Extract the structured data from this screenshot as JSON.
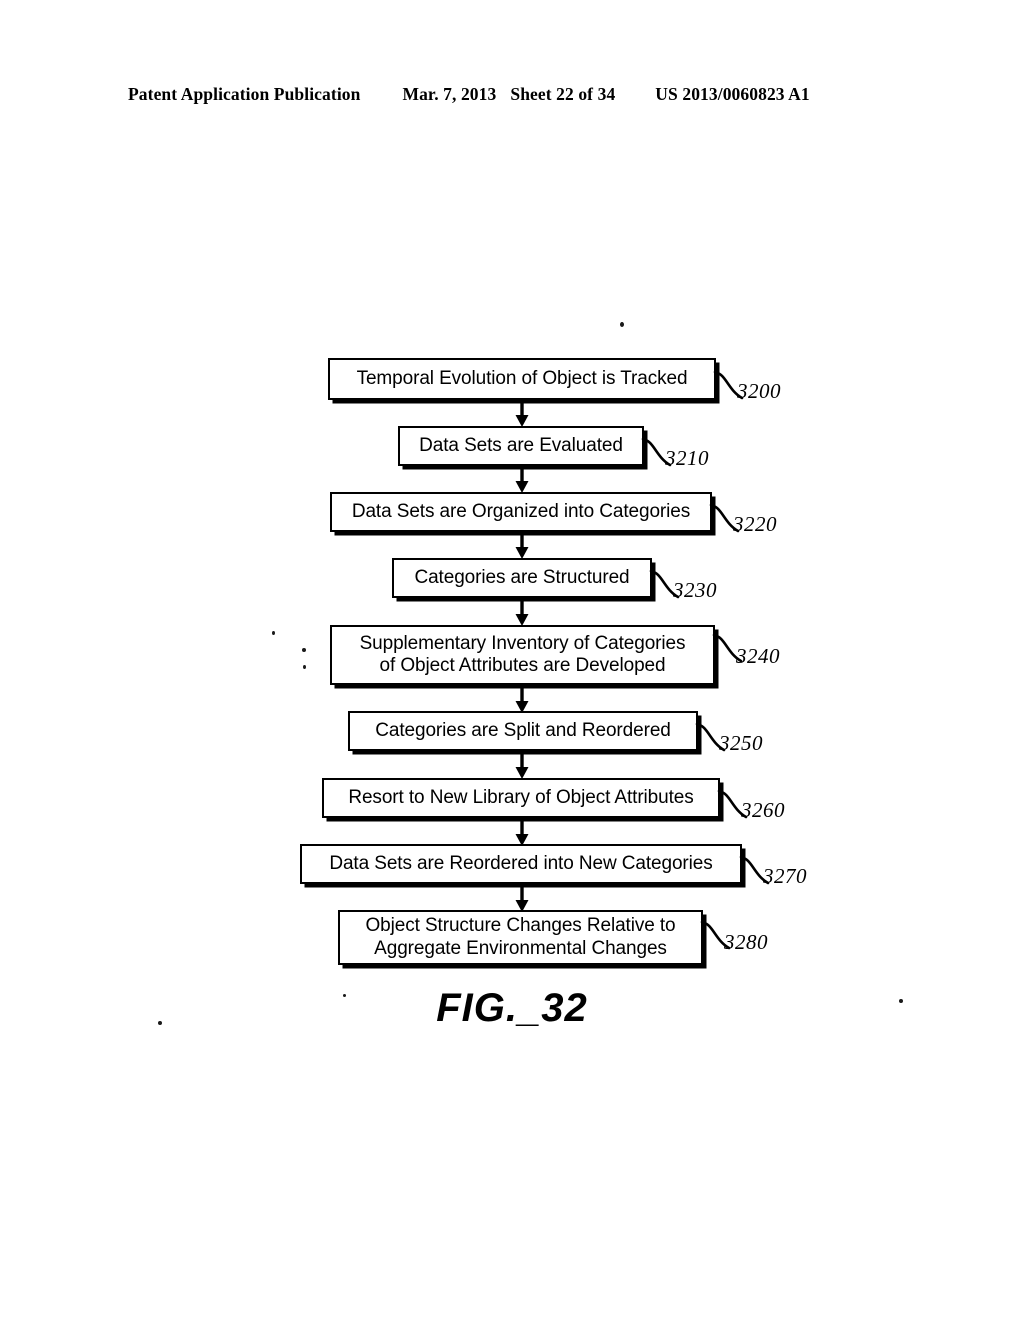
{
  "header": {
    "publication": "Patent Application Publication",
    "date": "Mar. 7, 2013",
    "sheet": "Sheet 22 of 34",
    "patent_number": "US 2013/0060823 A1"
  },
  "figure": {
    "caption": "FIG._32",
    "ink_color": "#000000",
    "background_color": "#ffffff"
  },
  "flowchart": {
    "type": "flowchart",
    "orientation": "top-to-bottom",
    "steps": [
      {
        "ref": "3200",
        "label": "Temporal Evolution of Object is Tracked"
      },
      {
        "ref": "3210",
        "label": "Data Sets are Evaluated"
      },
      {
        "ref": "3220",
        "label": "Data Sets are Organized into Categories"
      },
      {
        "ref": "3230",
        "label": "Categories are Structured"
      },
      {
        "ref": "3240",
        "label_line1": "Supplementary Inventory of Categories",
        "label_line2": "of Object Attributes are Developed"
      },
      {
        "ref": "3250",
        "label": "Categories are Split and Reordered"
      },
      {
        "ref": "3260",
        "label": "Resort to New Library of Object Attributes"
      },
      {
        "ref": "3270",
        "label": "Data Sets are Reordered into New Categories"
      },
      {
        "ref": "3280",
        "label_line1": "Object Structure Changes Relative to",
        "label_line2": "Aggregate Environmental Changes"
      }
    ]
  }
}
